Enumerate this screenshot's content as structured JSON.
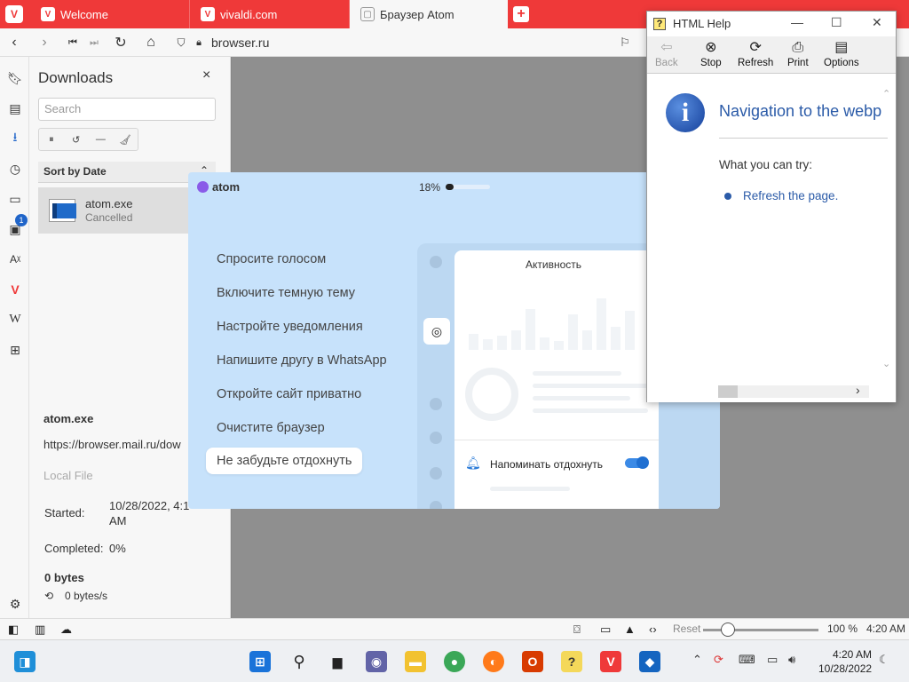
{
  "browser": {
    "tabs": [
      {
        "label": "Welcome",
        "icon": "vivaldi-icon"
      },
      {
        "label": "vivaldi.com",
        "icon": "vivaldi-icon"
      },
      {
        "label": "Браузер Atom",
        "icon": "page-icon"
      }
    ],
    "url": "browser.ru",
    "accent_color": "#ef3939"
  },
  "panel": {
    "badge_count": "1",
    "icons": [
      "bookmarks-icon",
      "reading-list-icon",
      "downloads-icon",
      "history-icon",
      "notes-icon",
      "window-icon",
      "translate-icon",
      "vivaldi-icon",
      "wikipedia-icon",
      "add-panel-icon",
      "settings-icon"
    ]
  },
  "downloads": {
    "title": "Downloads",
    "close": "×",
    "search_placeholder": "Search",
    "sort_label": "Sort by Date",
    "item": {
      "name": "atom.exe",
      "status": "Cancelled"
    },
    "details": {
      "name": "atom.exe",
      "url": "https://browser.mail.ru/dow",
      "local_file": "Local File",
      "started_label": "Started:",
      "started_value": "10/28/2022, 4:1",
      "started_value2": "AM",
      "completed_label": "Completed:",
      "completed_value": "0%",
      "size": "0 bytes",
      "speed": "0 bytes/s"
    }
  },
  "atom": {
    "logo": "atom",
    "progress_text": "18%",
    "progress": 0.18,
    "menu": [
      "Спросите голосом",
      "Включите темную тему",
      "Настройте уведомления",
      "Напишите другу в WhatsApp",
      "Откройте сайт приватно",
      "Очистите браузер",
      "Не забудьте отдохнуть"
    ],
    "card_title": "Активность",
    "remind_label": "Напоминать отдохнуть",
    "remind_on": true
  },
  "help": {
    "title": "HTML Help",
    "tools": [
      {
        "label": "Back",
        "icon": "back-arrow-icon",
        "enabled": false
      },
      {
        "label": "Stop",
        "icon": "stop-icon",
        "enabled": true
      },
      {
        "label": "Refresh",
        "icon": "refresh-icon",
        "enabled": true
      },
      {
        "label": "Print",
        "icon": "print-icon",
        "enabled": true
      },
      {
        "label": "Options",
        "icon": "options-icon",
        "enabled": true
      }
    ],
    "heading": "Navigation to the webp",
    "try_label": "What you can try:",
    "link": "Refresh the page."
  },
  "statusbar": {
    "reset": "Reset",
    "zoom": "100 %",
    "zoom_level": 1.0,
    "time": "4:20 AM"
  },
  "taskbar": {
    "time": "4:20 AM",
    "date": "10/28/2022"
  }
}
